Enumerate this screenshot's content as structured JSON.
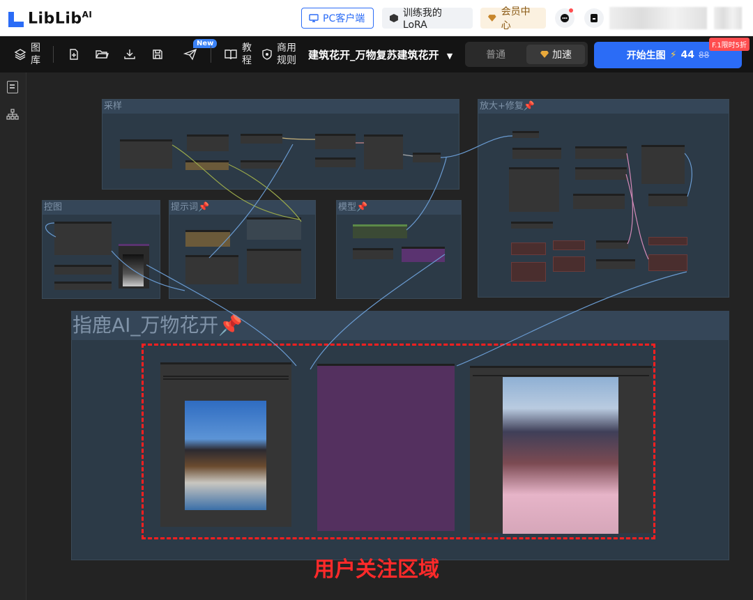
{
  "topbar": {
    "logo_text": "LibLib",
    "logo_sup": "AI",
    "pc_client": "PC客户端",
    "train_lora": "训练我的LoRA",
    "member_center": "会员中心"
  },
  "toolbar": {
    "library": "图库",
    "library_line1": "图",
    "library_line2": "库",
    "new_badge": "New",
    "tutorial_line1": "教",
    "tutorial_line2": "程",
    "commercial_line1": "商用",
    "commercial_line2": "规则",
    "workflow_title": "建筑花开_万物复苏建筑花开",
    "mode_normal": "普通",
    "mode_fast": "加速",
    "generate_label": "开始生图",
    "generate_cost": "44",
    "generate_cost_original": "88",
    "promo": "F.1限时5折"
  },
  "groups": {
    "sampling": "采样",
    "upscale": "放大+修复📌",
    "controlnet": "控图",
    "prompt": "提示词📌",
    "model": "模型📌",
    "main": "指鹿AI_万物花开📌"
  },
  "caption": "用户关注区域",
  "colors": {
    "accent": "#2b6cf6",
    "focus": "#ff1f1f",
    "group_bg": "#2c3a47"
  }
}
